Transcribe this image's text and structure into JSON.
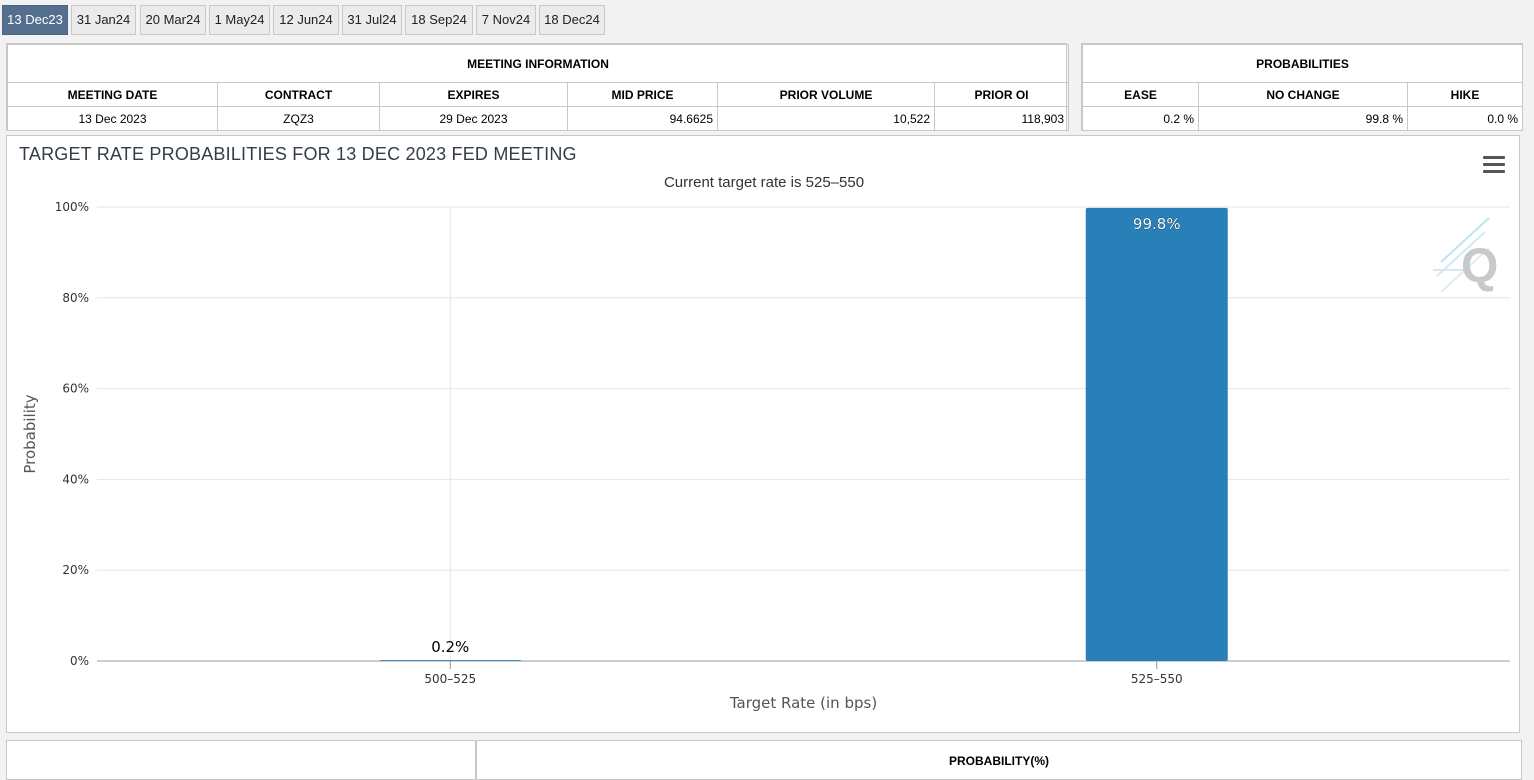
{
  "tabs": [
    {
      "label": "13 Dec23",
      "active": true
    },
    {
      "label": "31 Jan24",
      "active": false
    },
    {
      "label": "20 Mar24",
      "active": false
    },
    {
      "label": "1 May24",
      "active": false
    },
    {
      "label": "12 Jun24",
      "active": false
    },
    {
      "label": "31 Jul24",
      "active": false
    },
    {
      "label": "18 Sep24",
      "active": false
    },
    {
      "label": "7 Nov24",
      "active": false
    },
    {
      "label": "18 Dec24",
      "active": false
    }
  ],
  "meeting_info": {
    "title": "MEETING INFORMATION",
    "headers": [
      "MEETING DATE",
      "CONTRACT",
      "EXPIRES",
      "MID PRICE",
      "PRIOR VOLUME",
      "PRIOR OI"
    ],
    "row": [
      "13 Dec 2023",
      "ZQZ3",
      "29 Dec 2023",
      "94.6625",
      "10,522",
      "118,903"
    ]
  },
  "probabilities": {
    "title": "PROBABILITIES",
    "headers": [
      "EASE",
      "NO CHANGE",
      "HIKE"
    ],
    "row": [
      "0.2 %",
      "99.8 %",
      "0.0 %"
    ]
  },
  "chart": {
    "title": "TARGET RATE PROBABILITIES FOR 13 DEC 2023 FED MEETING",
    "subtitle": "Current target rate is 525–550",
    "bar_color": "#2980b9",
    "logo_letter": "Q"
  },
  "chart_data": {
    "type": "bar",
    "categories": [
      "500–525",
      "525–550"
    ],
    "values": [
      0.2,
      99.8
    ],
    "data_labels": [
      "0.2%",
      "99.8%"
    ],
    "title": "TARGET RATE PROBABILITIES FOR 13 DEC 2023 FED MEETING",
    "subtitle": "Current target rate is 525–550",
    "xlabel": "Target Rate (in bps)",
    "ylabel": "Probability",
    "ylim": [
      0,
      100
    ],
    "yticks": [
      "0%",
      "20%",
      "40%",
      "60%",
      "80%",
      "100%"
    ],
    "grid": true
  },
  "bottom": {
    "probability_header": "PROBABILITY(%)"
  }
}
